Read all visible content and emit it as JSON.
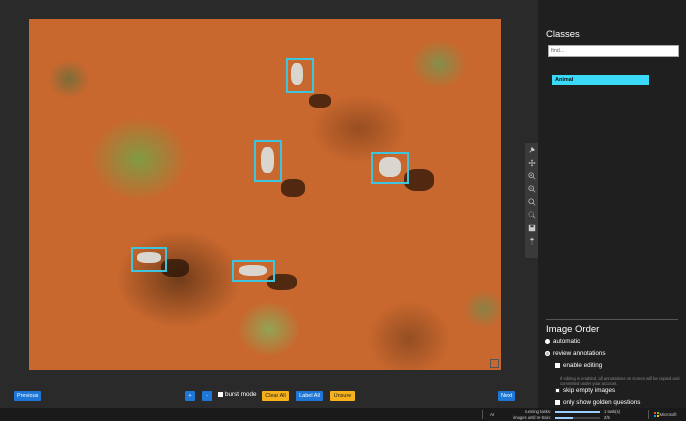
{
  "panel": {
    "classes_title": "Classes",
    "search_placeholder": "find...",
    "class_items": [
      "Animal"
    ],
    "image_order_title": "Image Order",
    "order_options": [
      "automatic",
      "review annotations"
    ],
    "enable_editing": "enable editing",
    "editing_note": "If editing is enabled, all annotations on screen will be copied and committed under your account.",
    "skip_empty": "skip empty images",
    "golden": "only show golden questions"
  },
  "toolbar": {
    "previous": "Previous",
    "add": "+",
    "remove": "-",
    "burst_mode": "burst mode",
    "clear_all": "Clear All",
    "label_all": "Label All",
    "unsure": "Unsure",
    "next": "Next"
  },
  "statusbar": {
    "ai_label": "AI",
    "running_tasks_label": "running tasks:",
    "running_tasks_value": "1 task(s)",
    "until_retrain_label": "images until re-train:",
    "until_retrain_value": "2/5",
    "until_retrain_progress": 0.4,
    "brand": "Microsoft"
  },
  "colors": {
    "bbox": "#3fc4dd",
    "class_animal": "#39d9f7",
    "button_blue": "#1e77d6",
    "button_yellow": "#f6b11d"
  },
  "icons": [
    "pin-icon",
    "move-icon",
    "zoom-in-icon",
    "zoom-out-icon",
    "zoom-reset-icon",
    "zoom-select-icon",
    "save-icon",
    "slider-icon"
  ]
}
